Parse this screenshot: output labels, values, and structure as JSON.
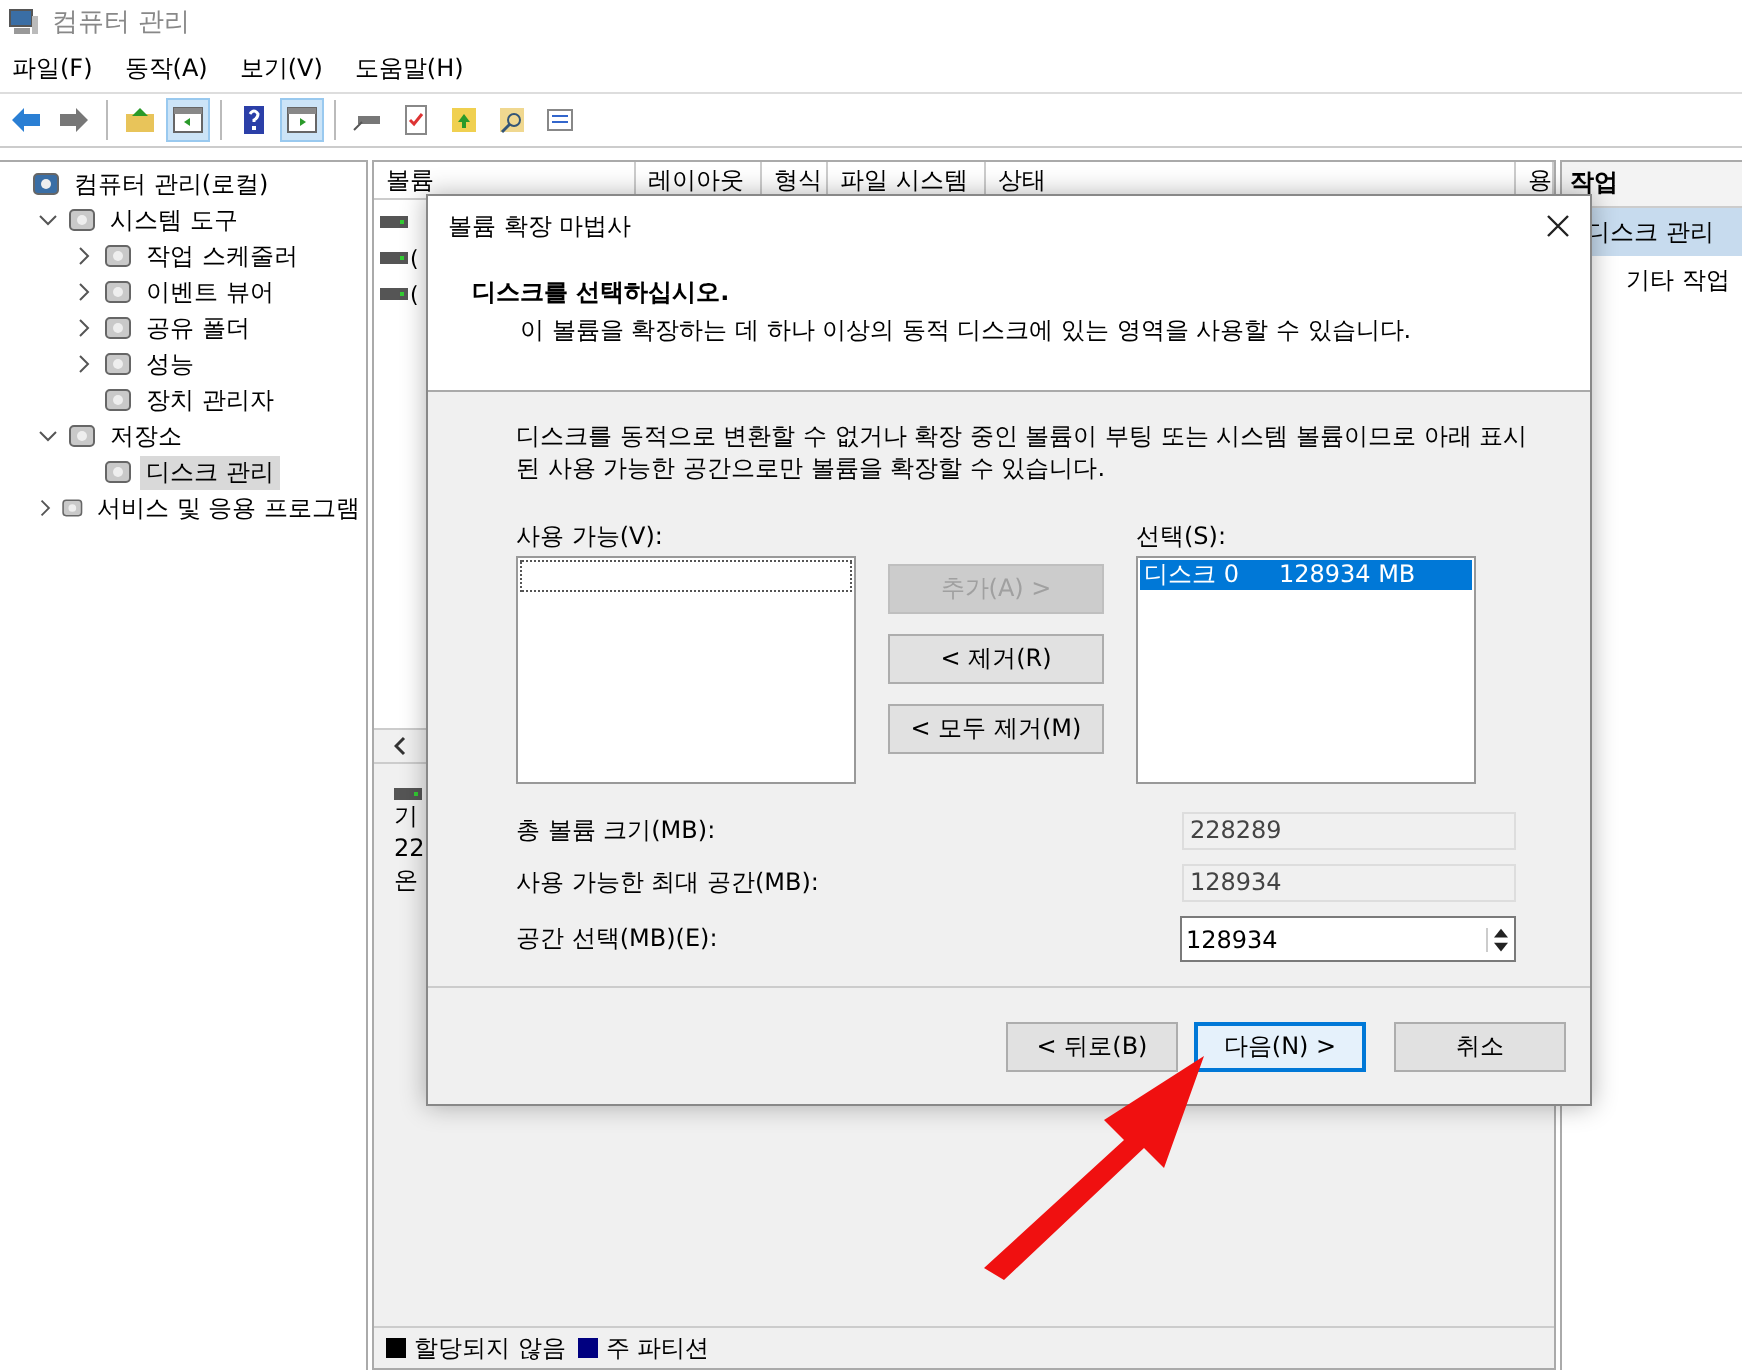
{
  "window": {
    "title": "컴퓨터 관리"
  },
  "menu": [
    "파일(F)",
    "동작(A)",
    "보기(V)",
    "도움말(H)"
  ],
  "toolbar": [
    {
      "selected": false
    },
    {
      "selected": false
    },
    {
      "selected": false
    },
    {
      "selected": true
    },
    {
      "selected": false
    },
    {
      "selected": true
    },
    {
      "selected": false
    },
    {
      "selected": false
    },
    {
      "selected": false
    },
    {
      "selected": false
    },
    {
      "selected": false
    }
  ],
  "tree": [
    {
      "label": "컴퓨터 관리(로컬)",
      "selected": false,
      "children": [
        {
          "label": "시스템 도구",
          "expanded": true,
          "selected": false,
          "children": [
            {
              "label": "작업 스케줄러",
              "expanded": false,
              "selected": false
            },
            {
              "label": "이벤트 뷰어",
              "expanded": false,
              "selected": false
            },
            {
              "label": "공유 폴더",
              "expanded": false,
              "selected": false
            },
            {
              "label": "성능",
              "expanded": false,
              "selected": false
            },
            {
              "label": "장치 관리자",
              "selected": false
            }
          ]
        },
        {
          "label": "저장소",
          "expanded": true,
          "selected": false,
          "children": [
            {
              "label": "디스크 관리",
              "selected": true
            }
          ]
        },
        {
          "label": "서비스 및 응용 프로그램",
          "expanded": false,
          "selected": false
        }
      ]
    }
  ],
  "table": {
    "columns": [
      "볼륨",
      "레이아웃",
      "형식",
      "파일 시스템",
      "상태",
      "용"
    ],
    "rows": [
      {
        "column_1": ""
      },
      {
        "column_1": "("
      },
      {
        "column_1": "("
      }
    ]
  },
  "lower_pane": {
    "lines": [
      "기",
      "22",
      "온"
    ]
  },
  "legend": [
    {
      "label": "할당되지 않음",
      "color": "#000000"
    },
    {
      "label": "주 파티션",
      "color": "#000080"
    }
  ],
  "actions": {
    "title": "작업",
    "items": [
      {
        "label": "디스크 관리",
        "selected": true
      },
      {
        "label": "기타 작업",
        "selected": false
      }
    ]
  },
  "dialog": {
    "title": "볼륨 확장 마법사",
    "heading": "디스크를 선택하십시오.",
    "subheading": "이 볼륨을 확장하는 데 하나 이상의 동적 디스크에 있는 영역을 사용할 수 있습니다.",
    "description": "디스크를 동적으로 변환할 수 없거나 확장 중인 볼륨이 부팅 또는 시스템 볼륨이므로 아래 표시된 사용 가능한 공간으로만 볼륨을 확장할 수 있습니다.",
    "available_label": "사용 가능(V):",
    "selected_label": "선택(S):",
    "selected_items": [
      {
        "disk": "디스크 0",
        "size": "128934 MB",
        "selected": true
      }
    ],
    "move_buttons": [
      {
        "label": "추가(A) >",
        "disabled": true
      },
      {
        "label": "< 제거(R)",
        "disabled": false
      },
      {
        "label": "< 모두 제거(M)",
        "disabled": false
      }
    ],
    "fields": [
      {
        "label": "총 볼륨 크기(MB):",
        "value": "228289",
        "kind": "readonly"
      },
      {
        "label": "사용 가능한 최대 공간(MB):",
        "value": "128934",
        "kind": "readonly"
      },
      {
        "label": "공간 선택(MB)(E):",
        "value": "128934",
        "kind": "spin"
      }
    ],
    "buttons": [
      {
        "label": "< 뒤로(B)",
        "focused": false
      },
      {
        "label": "다음(N) >",
        "focused": true
      },
      {
        "label": "취소",
        "focused": false
      }
    ]
  }
}
